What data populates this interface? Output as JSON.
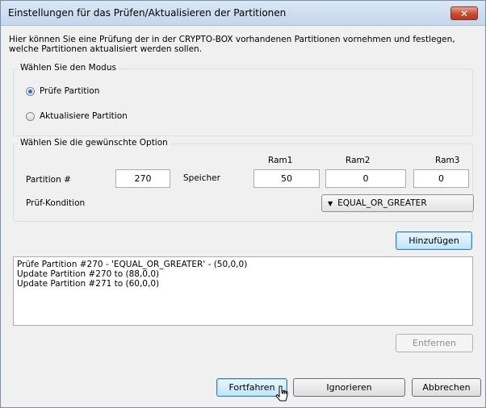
{
  "window": {
    "title": "Einstellungen für das Prüfen/Aktualisieren der Partitionen",
    "close_glyph": "✕",
    "description_line1": "Hier können Sie eine Prüfung der in der CRYPTO-BOX vorhandenen Partitionen vornehmen und festlegen,",
    "description_line2": "welche Partitionen aktualisiert werden sollen."
  },
  "mode_group": {
    "legend": "Wählen Sie den Modus",
    "options": [
      {
        "label": "Prüfe Partition",
        "checked": true
      },
      {
        "label": "Aktualisiere Partition",
        "checked": false
      }
    ]
  },
  "option_group": {
    "legend": "Wählen Sie die gewünschte Option",
    "ram1_header": "Ram1",
    "ram2_header": "Ram2",
    "ram3_header": "Ram3",
    "partition_label": "Partition #",
    "partition_value": "270",
    "memory_label": "Speicher",
    "ram1_value": "50",
    "ram2_value": "0",
    "ram3_value": "0",
    "condition_label": "Prüf-Kondition",
    "condition_value": "EQUAL_OR_GREATER",
    "dropdown_arrow": "▼"
  },
  "buttons": {
    "add": "Hinzufügen",
    "remove": "Entfernen",
    "continue": "Fortfahren",
    "ignore": "Ignorieren",
    "cancel": "Abbrechen"
  },
  "list": [
    "Prüfe Partition #270 - 'EQUAL_OR_GREATER' - (50,0,0)",
    "Update Partition #270 to (88,0,0)",
    "Update Partition #271 to (60,0,0)"
  ],
  "colors": {
    "focus_button": "#bee6fd",
    "close_button": "#c74a34",
    "title_bar": "#c3d6ec",
    "radio_dot": "#2a6fd0"
  }
}
